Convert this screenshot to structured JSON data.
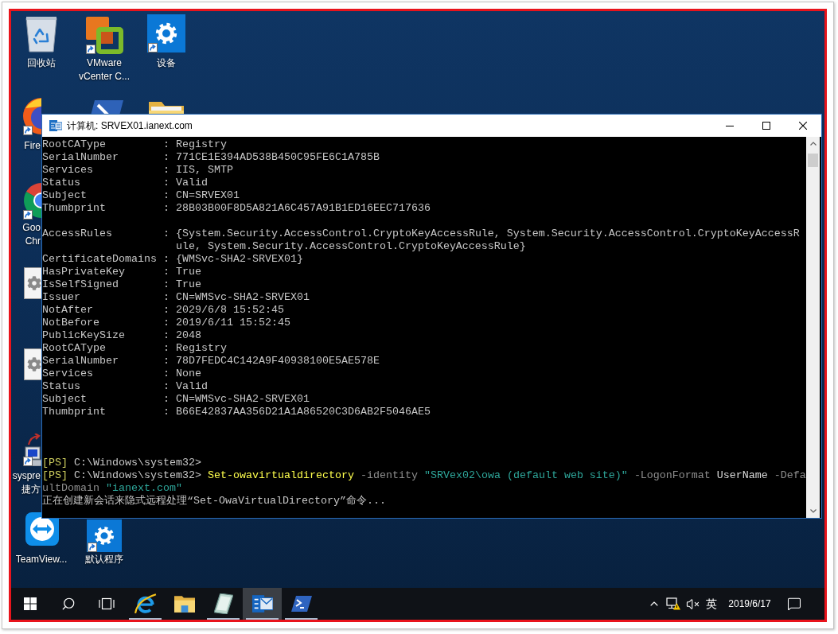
{
  "desktop": {
    "icons": [
      {
        "kind": "recycle-bin",
        "label": [
          "回收站"
        ],
        "shortcut": false
      },
      {
        "kind": "vmware",
        "label": [
          "VMware",
          "vCenter C..."
        ],
        "shortcut": true
      },
      {
        "kind": "gear-tile",
        "label": [
          "设备"
        ],
        "shortcut": true
      },
      {
        "kind": "firefox",
        "label": [
          "Fire"
        ],
        "shortcut": true
      },
      {
        "kind": "terminal"
      },
      {
        "kind": "folder"
      },
      {
        "kind": "chrome",
        "label": [
          "Goo",
          "Chr"
        ],
        "shortcut": true
      },
      {
        "kind": "installer"
      },
      {
        "kind": "installer"
      },
      {
        "kind": "monitor",
        "label": [
          "syspre",
          "捷方"
        ],
        "shortcut": true
      },
      {
        "kind": "teamviewer",
        "label": [
          "TeamView..."
        ],
        "shortcut": false
      },
      {
        "kind": "gear-tile",
        "label": [
          "默认程序"
        ],
        "shortcut": true
      }
    ]
  },
  "window": {
    "title": "计算机: SRVEX01.ianext.com",
    "console": {
      "lines": [
        {
          "kind": "output",
          "text": "RootCAType         : Registry"
        },
        {
          "kind": "output",
          "text": "SerialNumber       : 771CE1E394AD538B450C95FE6C1A785B"
        },
        {
          "kind": "output",
          "text": "Services           : IIS, SMTP"
        },
        {
          "kind": "output",
          "text": "Status             : Valid"
        },
        {
          "kind": "output",
          "text": "Subject            : CN=SRVEX01"
        },
        {
          "kind": "output",
          "text": "Thumbprint         : 28B03B00F8D5A821A6C457A91B1ED16EEC717636"
        },
        {
          "kind": "blank"
        },
        {
          "kind": "output",
          "text": "AccessRules        : {System.Security.AccessControl.CryptoKeyAccessRule, System.Security.AccessControl.CryptoKeyAccessR"
        },
        {
          "kind": "continuation",
          "text": "ule, System.Security.AccessControl.CryptoKeyAccessRule}"
        },
        {
          "kind": "output",
          "text": "CertificateDomains : {WMSvc-SHA2-SRVEX01}"
        },
        {
          "kind": "output",
          "text": "HasPrivateKey      : True"
        },
        {
          "kind": "output",
          "text": "IsSelfSigned       : True"
        },
        {
          "kind": "output",
          "text": "Issuer             : CN=WMSvc-SHA2-SRVEX01"
        },
        {
          "kind": "output",
          "text": "NotAfter           : 2029/6/8 15:52:45"
        },
        {
          "kind": "output",
          "text": "NotBefore          : 2019/6/11 15:52:45"
        },
        {
          "kind": "output",
          "text": "PublicKeySize      : 2048"
        },
        {
          "kind": "output",
          "text": "RootCAType         : Registry"
        },
        {
          "kind": "output",
          "text": "SerialNumber       : 78D7FEDC4C142A9F40938100E5AE578E"
        },
        {
          "kind": "output",
          "text": "Services           : None"
        },
        {
          "kind": "output",
          "text": "Status             : Valid"
        },
        {
          "kind": "output",
          "text": "Subject            : CN=WMSvc-SHA2-SRVEX01"
        },
        {
          "kind": "output",
          "text": "Thumbprint         : B66E42837AA356D21A1A86520C3D6AB2F5046AE5"
        },
        {
          "kind": "blank"
        },
        {
          "kind": "blank"
        },
        {
          "kind": "blank"
        },
        {
          "kind": "command",
          "segments": [
            {
              "kind": "prompt-tag",
              "text": "[PS]"
            },
            {
              "kind": "path",
              "text": "C:\\Windows\\system32>"
            }
          ]
        },
        {
          "kind": "command",
          "segments": [
            {
              "kind": "prompt-tag",
              "text": "[PS]"
            },
            {
              "kind": "path",
              "text": "C:\\Windows\\system32>"
            },
            {
              "kind": "command",
              "text": "Set-owavirtualdirectory"
            },
            {
              "kind": "parameter",
              "text": "-identity"
            },
            {
              "kind": "string",
              "text": "\"SRVex02\\owa (default web site)\""
            },
            {
              "kind": "parameter",
              "text": "-LogonFormat"
            },
            {
              "kind": "argument",
              "text": "UserName"
            },
            {
              "kind": "parameter",
              "text": "-Defa"
            }
          ]
        },
        {
          "kind": "command",
          "segments": [
            {
              "kind": "parameter",
              "text": "ultDomain"
            },
            {
              "kind": "string",
              "text": "\"ianext.com\""
            }
          ]
        },
        {
          "kind": "output",
          "text": "正在创建新会话来隐式远程处理“Set-OwaVirtualDirectory”命令..."
        }
      ]
    }
  },
  "taskbar": {
    "system_buttons": [
      {
        "kind": "start"
      },
      {
        "kind": "search"
      },
      {
        "kind": "task-view"
      }
    ],
    "apps": [
      {
        "kind": "ie",
        "running": true,
        "selected": false
      },
      {
        "kind": "explorer",
        "running": false,
        "selected": false
      },
      {
        "kind": "sheet",
        "running": true,
        "selected": false
      },
      {
        "kind": "exchange",
        "running": true,
        "selected": true
      },
      {
        "kind": "powershell",
        "running": true,
        "selected": false
      }
    ],
    "tray": {
      "icons": [
        {
          "kind": "chevron"
        },
        {
          "kind": "network-warning"
        },
        {
          "kind": "volume-muted"
        }
      ],
      "ime": "英",
      "date": "2019/6/17"
    }
  }
}
